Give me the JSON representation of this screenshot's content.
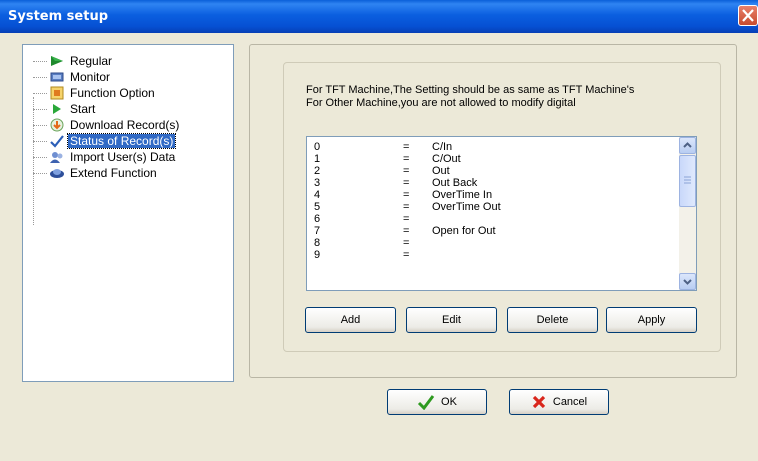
{
  "window": {
    "title": "System setup"
  },
  "tree": {
    "items": [
      {
        "label": "Regular",
        "icon": "arrow-right-icon"
      },
      {
        "label": "Monitor",
        "icon": "monitor-icon"
      },
      {
        "label": "Function Option",
        "icon": "options-icon"
      },
      {
        "label": "Start",
        "icon": "play-icon"
      },
      {
        "label": "Download Record(s)",
        "icon": "download-icon"
      },
      {
        "label": "Status of Record(s)",
        "icon": "check-icon",
        "selected": true
      },
      {
        "label": "Import User(s) Data",
        "icon": "import-icon"
      },
      {
        "label": "Extend Function",
        "icon": "extend-icon"
      }
    ]
  },
  "info": {
    "line1": "For TFT Machine,The Setting should be as same as TFT Machine's",
    "line2": "For Other Machine,you are not  allowed to modify digital"
  },
  "records": {
    "rows": [
      {
        "num": "0",
        "eq": "=",
        "val": "C/In"
      },
      {
        "num": "1",
        "eq": "=",
        "val": "C/Out"
      },
      {
        "num": "2",
        "eq": "=",
        "val": "Out"
      },
      {
        "num": "3",
        "eq": "=",
        "val": "Out Back"
      },
      {
        "num": "4",
        "eq": "=",
        "val": "OverTime In"
      },
      {
        "num": "5",
        "eq": "=",
        "val": "OverTime Out"
      },
      {
        "num": "6",
        "eq": "=",
        "val": ""
      },
      {
        "num": "7",
        "eq": "=",
        "val": "Open for Out"
      },
      {
        "num": "8",
        "eq": "=",
        "val": ""
      },
      {
        "num": "9",
        "eq": "=",
        "val": ""
      }
    ]
  },
  "buttons": {
    "add": "Add",
    "edit": "Edit",
    "delete": "Delete",
    "apply": "Apply",
    "ok": "OK",
    "cancel": "Cancel"
  },
  "colors": {
    "titlebar": "#0a5fd9",
    "selection": "#316ac5",
    "ok_check": "#2e9a20",
    "cancel_x": "#d9261c"
  }
}
